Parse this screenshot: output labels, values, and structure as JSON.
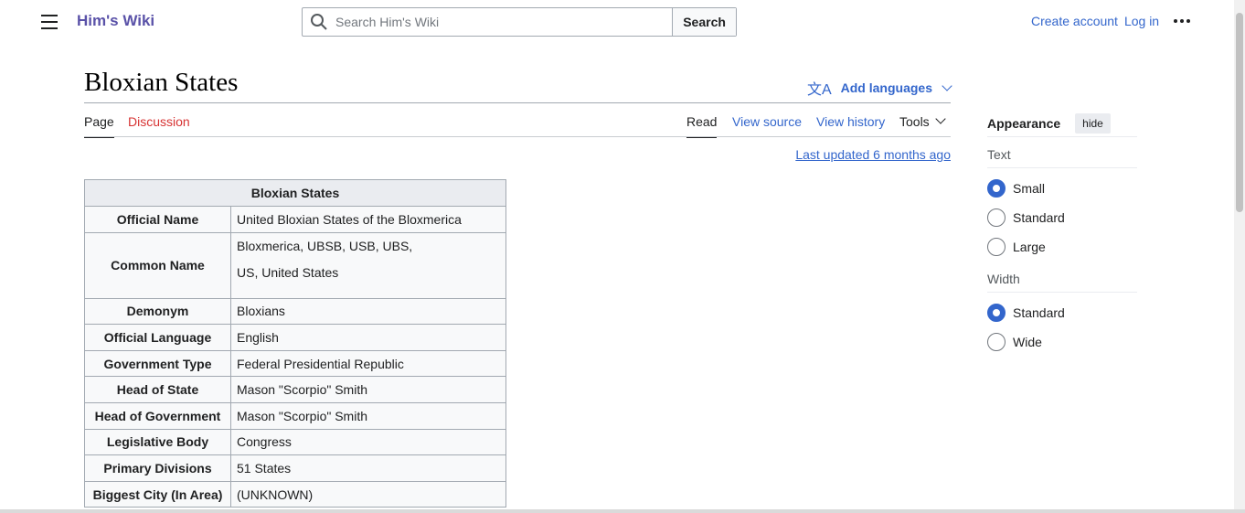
{
  "header": {
    "logo": "Him's Wiki",
    "search_placeholder": "Search Him's Wiki",
    "search_button": "Search",
    "create_account": "Create account",
    "log_in": "Log in",
    "icons": {
      "menu": "hamburger-icon",
      "search": "magnifier-icon",
      "more": "ellipsis-icon"
    }
  },
  "page": {
    "title": "Bloxian States",
    "add_languages": "Add languages",
    "tabs_left": [
      "Page",
      "Discussion"
    ],
    "tabs_right": [
      "Read",
      "View source",
      "View history",
      "Tools"
    ],
    "last_updated": "Last updated 6 months ago"
  },
  "infobox": {
    "caption": "Bloxian States",
    "rows": [
      {
        "label": "Official Name",
        "value": "United Bloxian States of the Bloxmerica"
      },
      {
        "label": "Common Name",
        "value": "Bloxmerica, UBSB, USB, UBS,",
        "value2": "US, United States"
      },
      {
        "label": "Demonym",
        "value": "Bloxians"
      },
      {
        "label": "Official Language",
        "value": "English"
      },
      {
        "label": "Government Type",
        "value": "Federal Presidential Republic"
      },
      {
        "label": "Head of State",
        "value": "Mason \"Scorpio\" Smith"
      },
      {
        "label": "Head of Government",
        "value": "Mason \"Scorpio\" Smith"
      },
      {
        "label": "Legislative Body",
        "value": "Congress"
      },
      {
        "label": "Primary Divisions",
        "value": "51 States"
      },
      {
        "label": "Biggest City (In Area)",
        "value": "(UNKNOWN)"
      }
    ]
  },
  "appearance": {
    "title": "Appearance",
    "hide": "hide",
    "text_label": "Text",
    "text_options": [
      "Small",
      "Standard",
      "Large"
    ],
    "text_selected": "Small",
    "width_label": "Width",
    "width_options": [
      "Standard",
      "Wide"
    ],
    "width_selected": "Standard"
  },
  "colors": {
    "link": "#3366cc",
    "logo": "#5a52a8",
    "discussion": "#d73333"
  }
}
